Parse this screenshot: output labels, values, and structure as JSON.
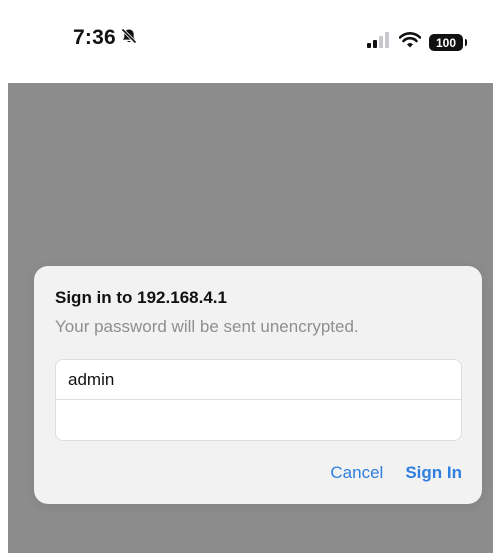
{
  "status_bar": {
    "time": "7:36",
    "silent_icon": "bell-slash-icon",
    "signal_icon": "cellular-signal-icon",
    "wifi_icon": "wifi-icon",
    "battery_level": "100"
  },
  "dialog": {
    "title": "Sign in to 192.168.4.1",
    "message": "Your password will be sent unencrypted.",
    "username_value": "admin",
    "password_value": "",
    "cancel_label": "Cancel",
    "sign_in_label": "Sign In"
  },
  "colors": {
    "accent": "#2f7fe0",
    "overlay": "#8c8c8c",
    "dialog_bg": "#f2f2f2",
    "secondary_text": "#8e8e93"
  }
}
